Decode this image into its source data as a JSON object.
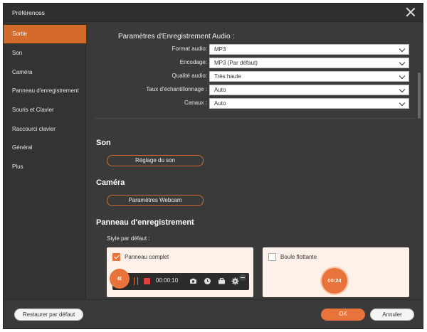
{
  "window": {
    "title": "Préférences"
  },
  "sidebar": {
    "items": [
      {
        "label": "Sortie",
        "active": true
      },
      {
        "label": "Son"
      },
      {
        "label": "Caméra"
      },
      {
        "label": "Panneau d'enregistrement"
      },
      {
        "label": "Souris et Clavier"
      },
      {
        "label": "Raccourci clavier"
      },
      {
        "label": "Général"
      },
      {
        "label": "Plus"
      }
    ]
  },
  "audio": {
    "title": "Paramètres d'Enregistrement Audio :",
    "fields": [
      {
        "label": "Format audio:",
        "value": "MP3"
      },
      {
        "label": "Encodage:",
        "value": "MP3 (Par défaut)"
      },
      {
        "label": "Qualité audio:",
        "value": "Très haute"
      },
      {
        "label": "Taux d'échantillonnage :",
        "value": "Auto"
      },
      {
        "label": "Canaux :",
        "value": "Auto"
      }
    ]
  },
  "sound": {
    "heading": "Son",
    "button": "Réglage du son"
  },
  "camera": {
    "heading": "Caméra",
    "button": "Paramètres Webcam"
  },
  "panel": {
    "heading": "Panneau d'enregistrement",
    "style_label": "Style par défaut :",
    "option_full": {
      "label": "Panneau complet",
      "checked": true
    },
    "option_float": {
      "label": "Boule flottante",
      "checked": false
    },
    "toolbar": {
      "collapse_glyph": "«",
      "timer": "00:00:10"
    },
    "ball_timer": "00:24"
  },
  "footer": {
    "restore": "Restaurer par défaut",
    "ok": "OK",
    "cancel": "Annuler"
  },
  "colors": {
    "accent": "#e8743b",
    "bg": "#3a3a3a",
    "sidebar_active": "#d46a2b"
  }
}
